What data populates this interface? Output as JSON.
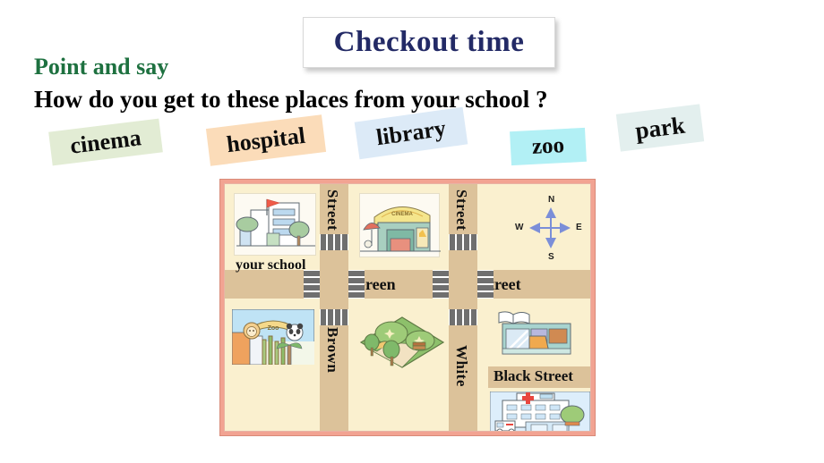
{
  "slide": {
    "title": "Checkout time",
    "section_heading": "Point and say",
    "question": "How do you get to these places from your school ?"
  },
  "word_chips": [
    {
      "label": "cinema",
      "color": "#e2ecd4"
    },
    {
      "label": "hospital",
      "color": "#fbdcb9"
    },
    {
      "label": "library",
      "color": "#dceaf7"
    },
    {
      "label": "zoo",
      "color": "#b2f0f5"
    },
    {
      "label": "park",
      "color": "#e3efee"
    }
  ],
  "map": {
    "border_color": "#f2a392",
    "block_color": "#faf0cf",
    "road_color": "#dcc29a",
    "streets": {
      "vertical_top_left": "Street",
      "vertical_top_right": "Street",
      "vertical_bottom_left": "Brown",
      "vertical_bottom_right": "White",
      "horizontal_left": "Green",
      "horizontal_right": "Street",
      "horizontal_bottom_right": "Black Street"
    },
    "places": {
      "school_caption": "your school",
      "cinema_sign": "CINEMA",
      "zoo_sign": "Zoo"
    },
    "compass": {
      "north": "N",
      "south": "S",
      "east": "E",
      "west": "W",
      "color": "#7b8ed8"
    }
  }
}
